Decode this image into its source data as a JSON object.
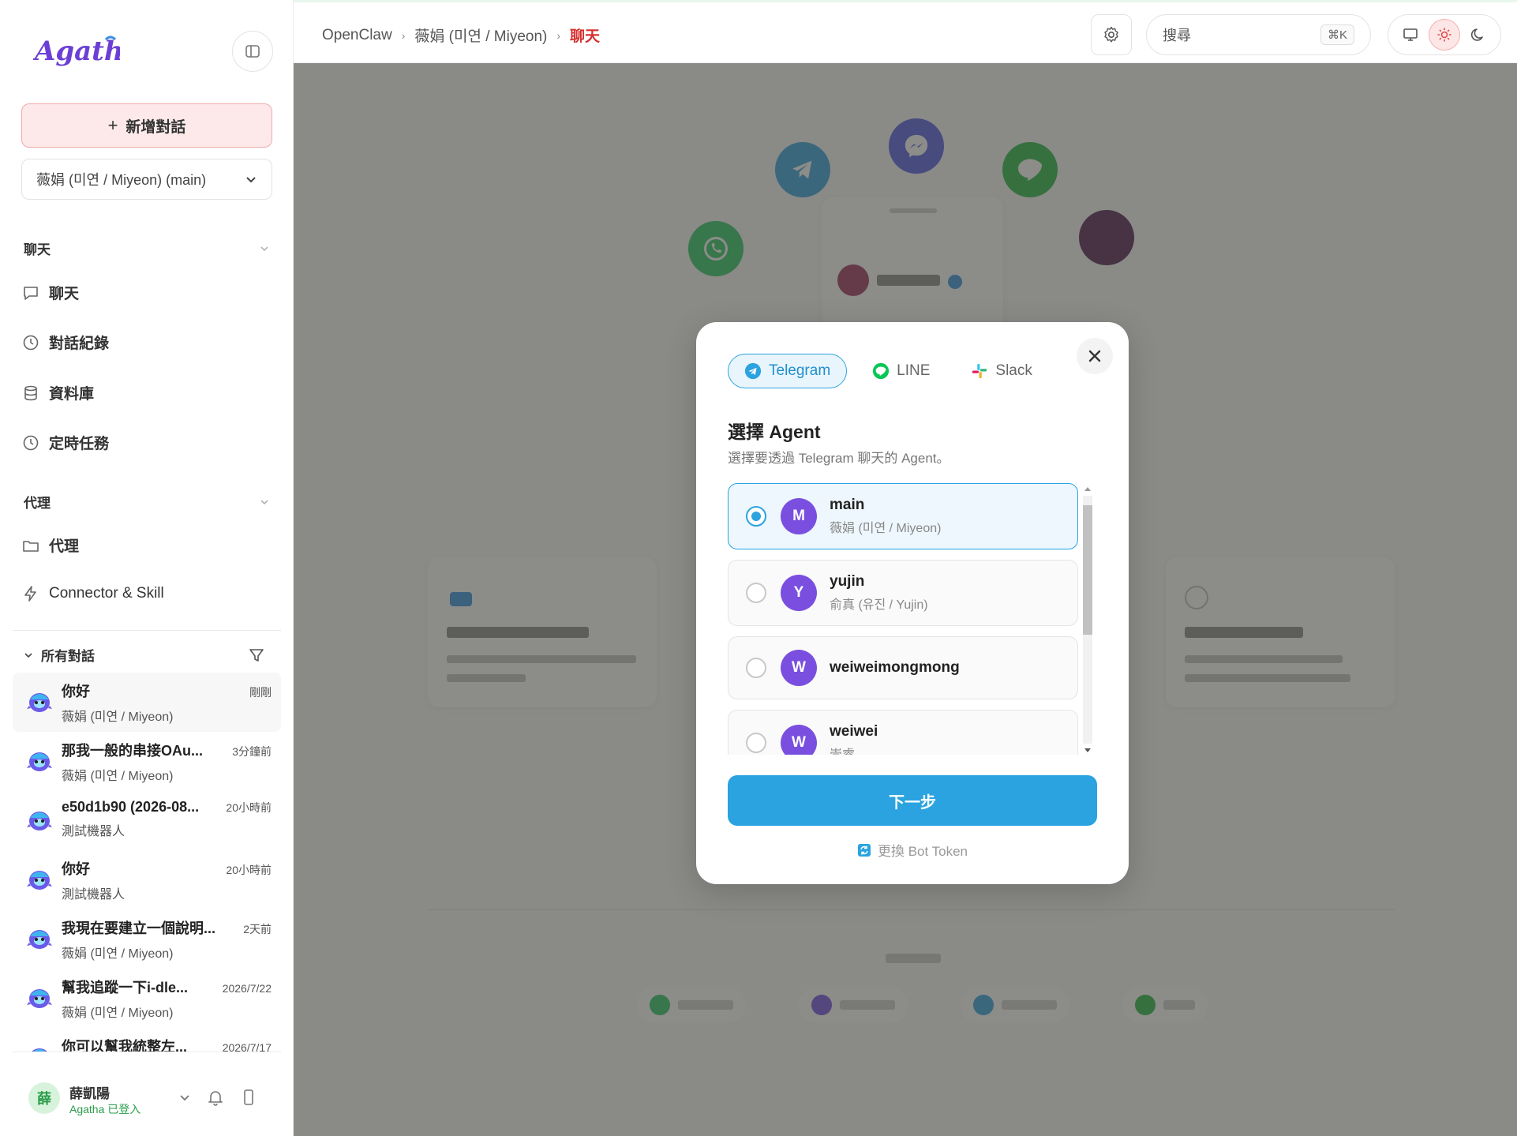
{
  "sidebar": {
    "logo_text": "Agatha",
    "new_chat_label": "新增對話",
    "agent_select_value": "薇娟 (미연 / Miyeon) (main)",
    "chat_section_label": "聊天",
    "nav_chat": "聊天",
    "nav_history": "對話紀錄",
    "nav_database": "資料庫",
    "nav_scheduled": "定時任務",
    "agent_section_label": "代理",
    "nav_agent": "代理",
    "nav_connector": "Connector & Skill",
    "all_conversations_label": "所有對話",
    "conversations": [
      {
        "title": "你好",
        "time": "剛剛",
        "subtitle": "薇娟 (미연 / Miyeon)"
      },
      {
        "title": "那我一般的串接OAu...",
        "time": "3分鐘前",
        "subtitle": "薇娟 (미연 / Miyeon)"
      },
      {
        "title": "e50d1b90 (2026-08...",
        "time": "20小時前",
        "subtitle": "測試機器人"
      },
      {
        "title": "你好",
        "time": "20小時前",
        "subtitle": "測試機器人"
      },
      {
        "title": "我現在要建立一個說明...",
        "time": "2天前",
        "subtitle": "薇娟 (미연 / Miyeon)"
      },
      {
        "title": "幫我追蹤一下i-dle...",
        "time": "2026/7/22",
        "subtitle": "薇娟 (미연 / Miyeon)"
      },
      {
        "title": "你可以幫我統整左...",
        "time": "2026/7/17",
        "subtitle": ""
      }
    ],
    "user": {
      "avatar_char": "薛",
      "name": "薛凱陽",
      "status": "Agatha 已登入"
    }
  },
  "topbar": {
    "breadcrumb": [
      "OpenClaw",
      "薇娟 (미연 / Miyeon)",
      "聊天"
    ],
    "search_placeholder": "搜尋",
    "search_shortcut": "⌘K"
  },
  "modal": {
    "tabs": [
      {
        "label": "Telegram",
        "active": true
      },
      {
        "label": "LINE",
        "active": false
      },
      {
        "label": "Slack",
        "active": false
      }
    ],
    "title": "選擇 Agent",
    "subtitle": "選擇要透過 Telegram 聊天的 Agent。",
    "agents": [
      {
        "initial": "M",
        "name": "main",
        "desc": "薇娟 (미연 / Miyeon)",
        "selected": true
      },
      {
        "initial": "Y",
        "name": "yujin",
        "desc": "俞真 (유진 / Yujin)",
        "selected": false
      },
      {
        "initial": "W",
        "name": "weiweimongmong",
        "desc": "",
        "selected": false
      },
      {
        "initial": "W",
        "name": "weiwei",
        "desc": "崇睿",
        "selected": false
      }
    ],
    "next_label": "下一步",
    "swap_token_label": "更換 Bot Token"
  },
  "colors": {
    "accent": "#2aa3e0",
    "danger": "#d63030",
    "agent_avatar": "#7a4fe0",
    "new_chat_bg": "#fde9e9"
  }
}
